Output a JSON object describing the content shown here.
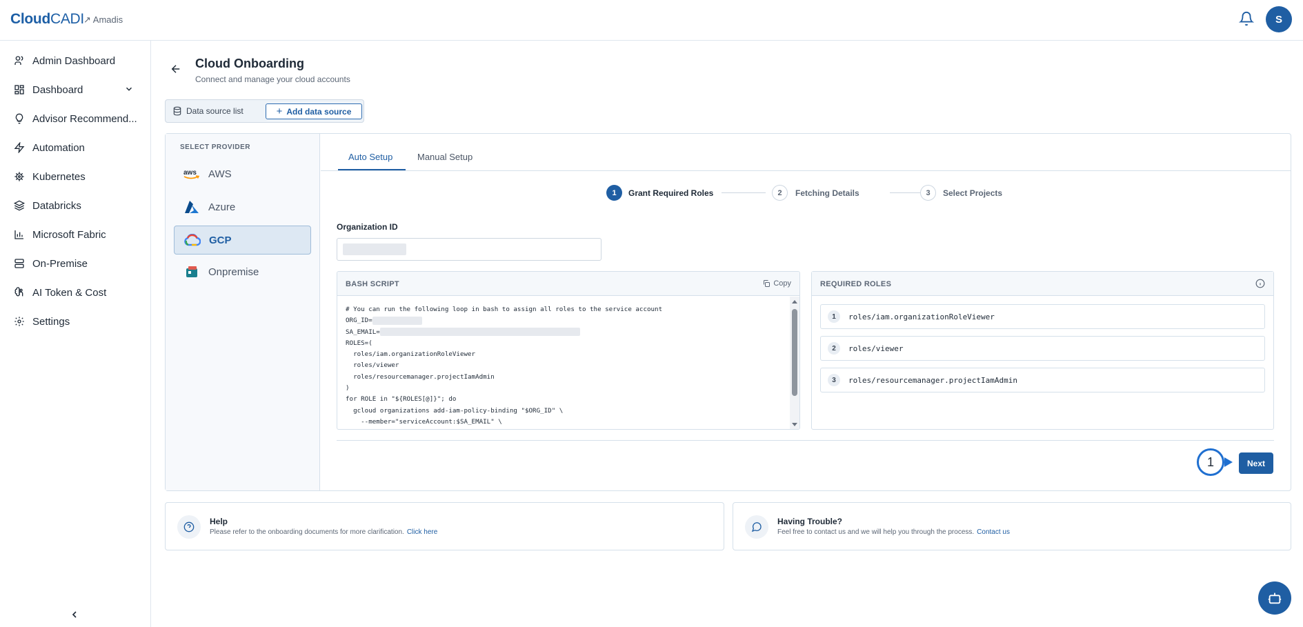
{
  "app": {
    "logo_bold": "Cloud",
    "logo_thin": "CADI",
    "tenant": "↗ Amadis",
    "avatar_letter": "S"
  },
  "sidebar": {
    "items": [
      {
        "label": "Admin Dashboard",
        "icon": "user-icon"
      },
      {
        "label": "Dashboard",
        "icon": "grid-icon",
        "expandable": true
      },
      {
        "label": "Advisor Recommend...",
        "icon": "lightbulb-icon"
      },
      {
        "label": "Automation",
        "icon": "lightning-icon"
      },
      {
        "label": "Kubernetes",
        "icon": "helm-icon"
      },
      {
        "label": "Databricks",
        "icon": "layers-icon"
      },
      {
        "label": "Microsoft Fabric",
        "icon": "bar-chart-icon"
      },
      {
        "label": "On-Premise",
        "icon": "server-icon"
      },
      {
        "label": "AI Token & Cost",
        "icon": "brain-icon"
      },
      {
        "label": "Settings",
        "icon": "gear-icon"
      }
    ]
  },
  "page": {
    "title": "Cloud Onboarding",
    "subtitle": "Connect and manage your cloud accounts"
  },
  "segment": {
    "list_label": "Data source list",
    "add_label": "Add data source"
  },
  "providers": {
    "heading": "SELECT PROVIDER",
    "items": [
      {
        "label": "AWS",
        "active": false
      },
      {
        "label": "Azure",
        "active": false
      },
      {
        "label": "GCP",
        "active": true
      },
      {
        "label": "Onpremise",
        "active": false
      }
    ]
  },
  "tabs": [
    {
      "label": "Auto Setup",
      "active": true
    },
    {
      "label": "Manual Setup",
      "active": false
    }
  ],
  "steps": [
    {
      "num": "1",
      "label": "Grant Required Roles",
      "active": true
    },
    {
      "num": "2",
      "label": "Fetching Details",
      "active": false
    },
    {
      "num": "3",
      "label": "Select Projects",
      "active": false
    }
  ],
  "org": {
    "label": "Organization ID"
  },
  "script": {
    "heading": "BASH SCRIPT",
    "copy_label": "Copy",
    "lines": [
      "# You can run the following loop in bash to assign all roles to the service account",
      "ORG_ID=",
      "SA_EMAIL=",
      "ROLES=(",
      "  roles/iam.organizationRoleViewer",
      "  roles/viewer",
      "  roles/resourcemanager.projectIamAdmin",
      ")",
      "for ROLE in \"${ROLES[@]}\"; do",
      "  gcloud organizations add-iam-policy-binding \"$ORG_ID\" \\",
      "    --member=\"serviceAccount:$SA_EMAIL\" \\"
    ]
  },
  "roles": {
    "heading": "REQUIRED ROLES",
    "items": [
      {
        "num": "1",
        "name": "roles/iam.organizationRoleViewer"
      },
      {
        "num": "2",
        "name": "roles/viewer"
      },
      {
        "num": "3",
        "name": "roles/resourcemanager.projectIamAdmin"
      }
    ]
  },
  "actions": {
    "next_label": "Next",
    "marker_label": "1"
  },
  "help": {
    "title": "Help",
    "desc": "Please refer to the onboarding documents for more clarification.",
    "link": "Click here"
  },
  "trouble": {
    "title": "Having Trouble?",
    "desc": "Feel free to contact us and we will help you through the process.",
    "link": "Contact us"
  },
  "colors": {
    "primary": "#1f5ea3",
    "border": "#d5e0ea",
    "marker": "#1f6fd0"
  }
}
